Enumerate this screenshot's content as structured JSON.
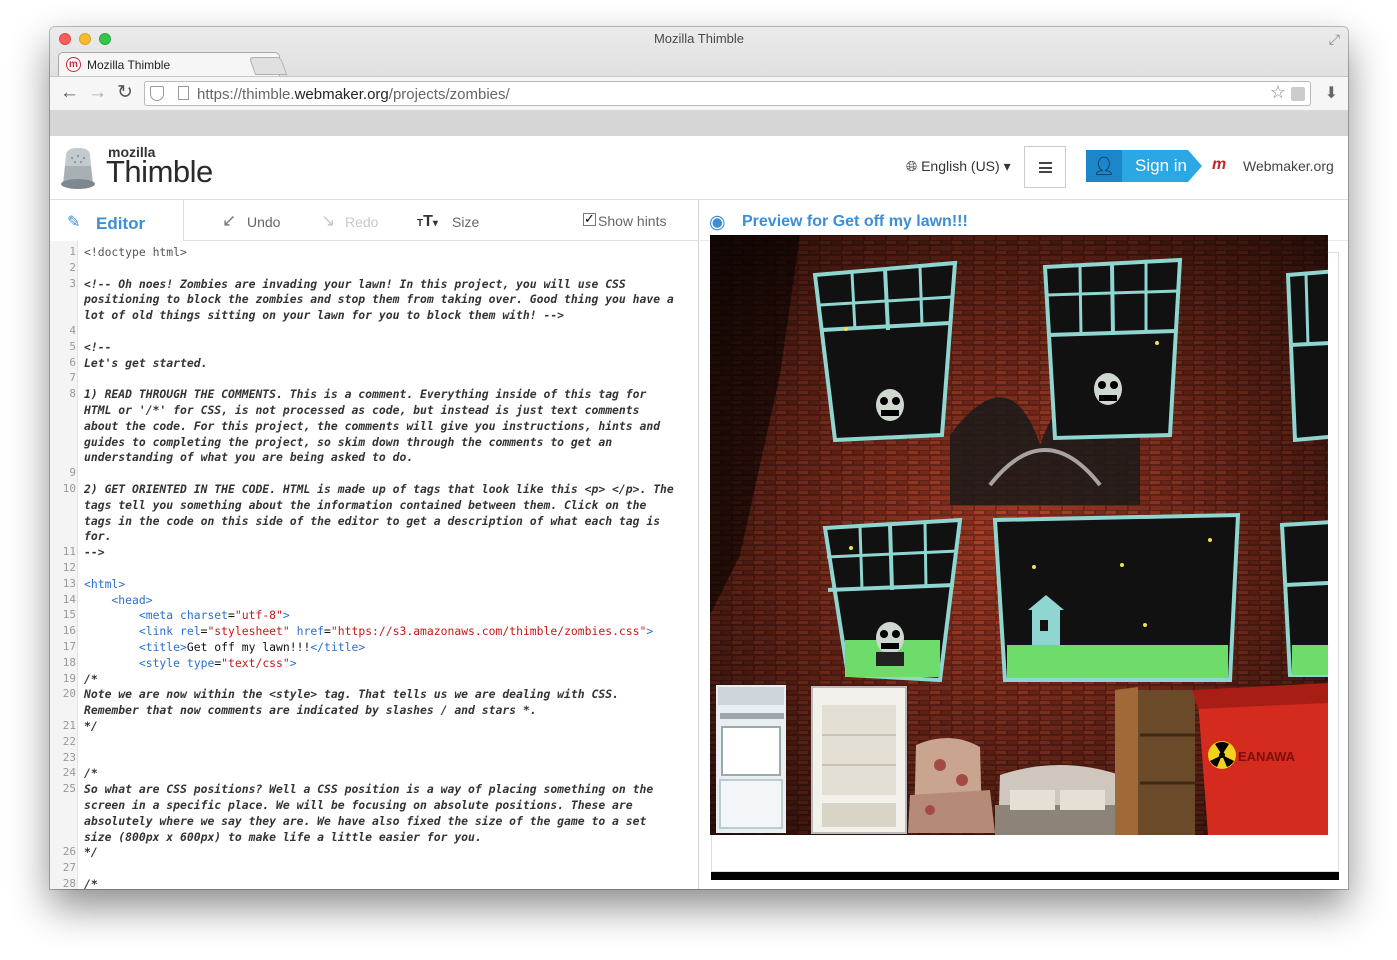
{
  "window": {
    "title": "Mozilla Thimble"
  },
  "tab": {
    "title": "Mozilla Thimble",
    "favicon": "m"
  },
  "address": {
    "scheme": "https://",
    "host_prefix": "thimble.",
    "host_main": "webmaker.org",
    "path": "/projects/zombies/"
  },
  "header": {
    "logo_small": "mozilla",
    "logo_big": "Thimble",
    "language": "English (US)",
    "sign_in": "Sign in",
    "webmaker_logo": "m",
    "webmaker_link": "Webmaker.org"
  },
  "editor": {
    "tab_label": "Editor",
    "undo": "Undo",
    "redo": "Redo",
    "size": "Size",
    "show_hints": "Show hints",
    "show_hints_checked": true
  },
  "preview": {
    "title": "Preview for Get off my lawn!!!"
  },
  "code_lines": [
    {
      "n": "1",
      "t": "<!doctype html>",
      "c": "dt"
    },
    {
      "n": "2",
      "t": "",
      "c": ""
    },
    {
      "n": "3",
      "t": "<!-- Oh noes! Zombies are invading your lawn! In this project, you will use CSS",
      "c": "cm"
    },
    {
      "n": "",
      "t": "positioning to block the zombies and stop them from taking over. Good thing you have a",
      "c": "cm"
    },
    {
      "n": "",
      "t": "lot of old things sitting on your lawn for you to block them with! -->",
      "c": "cm"
    },
    {
      "n": "4",
      "t": "",
      "c": ""
    },
    {
      "n": "5",
      "t": "<!--",
      "c": "cm"
    },
    {
      "n": "6",
      "t": "Let's get started.",
      "c": "cm"
    },
    {
      "n": "7",
      "t": "",
      "c": ""
    },
    {
      "n": "8",
      "t": "1) READ THROUGH THE COMMENTS. This is a comment. Everything inside of this tag for",
      "c": "cm"
    },
    {
      "n": "",
      "t": "HTML or '/*' for CSS, is not processed as code, but instead is just text comments",
      "c": "cm"
    },
    {
      "n": "",
      "t": "about the code. For this project, the comments will give you instructions, hints and",
      "c": "cm"
    },
    {
      "n": "",
      "t": "guides to completing the project, so skim down through the comments to get an",
      "c": "cm"
    },
    {
      "n": "",
      "t": "understanding of what you are being asked to do.",
      "c": "cm"
    },
    {
      "n": "9",
      "t": "",
      "c": ""
    },
    {
      "n": "10",
      "t": "2) GET ORIENTED IN THE CODE. HTML is made up of tags that look like this <p> </p>. The",
      "c": "cm"
    },
    {
      "n": "",
      "t": "tags tell you something about the information contained between them. Click on the",
      "c": "cm"
    },
    {
      "n": "",
      "t": "tags in the code on this side of the editor to get a description of what each tag is",
      "c": "cm"
    },
    {
      "n": "",
      "t": "for.",
      "c": "cm"
    },
    {
      "n": "11",
      "t": "-->",
      "c": "cm"
    },
    {
      "n": "12",
      "t": "",
      "c": ""
    },
    {
      "n": "13",
      "t": "<html>",
      "c": "tg"
    },
    {
      "n": "14",
      "t": "    <head>",
      "c": "tg"
    },
    {
      "n": "15",
      "t": "",
      "c": "",
      "segs": [
        [
          "        <meta ",
          "tg"
        ],
        [
          "charset",
          "at"
        ],
        [
          "=",
          "pl"
        ],
        [
          "\"utf-8\"",
          "st"
        ],
        [
          ">",
          "tg"
        ]
      ]
    },
    {
      "n": "16",
      "t": "",
      "c": "",
      "segs": [
        [
          "        <link ",
          "tg"
        ],
        [
          "rel",
          "at"
        ],
        [
          "=",
          "pl"
        ],
        [
          "\"stylesheet\"",
          "st"
        ],
        [
          " href",
          "at"
        ],
        [
          "=",
          "pl"
        ],
        [
          "\"https://s3.amazonaws.com/thimble/zombies.css\"",
          "st"
        ],
        [
          ">",
          "tg"
        ]
      ]
    },
    {
      "n": "17",
      "t": "",
      "c": "",
      "segs": [
        [
          "        <title>",
          "tg"
        ],
        [
          "Get off my lawn!!!",
          "pl"
        ],
        [
          "</title>",
          "tg"
        ]
      ]
    },
    {
      "n": "18",
      "t": "",
      "c": "",
      "segs": [
        [
          "        <style ",
          "tg"
        ],
        [
          "type",
          "at"
        ],
        [
          "=",
          "pl"
        ],
        [
          "\"text/css\"",
          "st"
        ],
        [
          ">",
          "tg"
        ]
      ]
    },
    {
      "n": "19",
      "t": "/*",
      "c": "cm"
    },
    {
      "n": "20",
      "t": "Note we are now within the <style> tag. That tells us we are dealing with CSS.",
      "c": "cm"
    },
    {
      "n": "",
      "t": "Remember that now comments are indicated by slashes / and stars *.",
      "c": "cm"
    },
    {
      "n": "21",
      "t": "*/",
      "c": "cm"
    },
    {
      "n": "22",
      "t": "",
      "c": ""
    },
    {
      "n": "23",
      "t": "",
      "c": ""
    },
    {
      "n": "24",
      "t": "/*",
      "c": "cm"
    },
    {
      "n": "25",
      "t": "So what are CSS positions? Well a CSS position is a way of placing something on the",
      "c": "cm"
    },
    {
      "n": "",
      "t": "screen in a specific place. We will be focusing on absolute positions. These are",
      "c": "cm"
    },
    {
      "n": "",
      "t": "absolutely where we say they are. We have also fixed the size of the game to a set",
      "c": "cm"
    },
    {
      "n": "",
      "t": "size (800px x 600px) to make life a little easier for you.",
      "c": "cm"
    },
    {
      "n": "26",
      "t": "*/",
      "c": "cm"
    },
    {
      "n": "27",
      "t": "",
      "c": ""
    },
    {
      "n": "28",
      "t": "/*",
      "c": "cm"
    }
  ],
  "scene": {
    "hazard_text": "EANAWA"
  }
}
